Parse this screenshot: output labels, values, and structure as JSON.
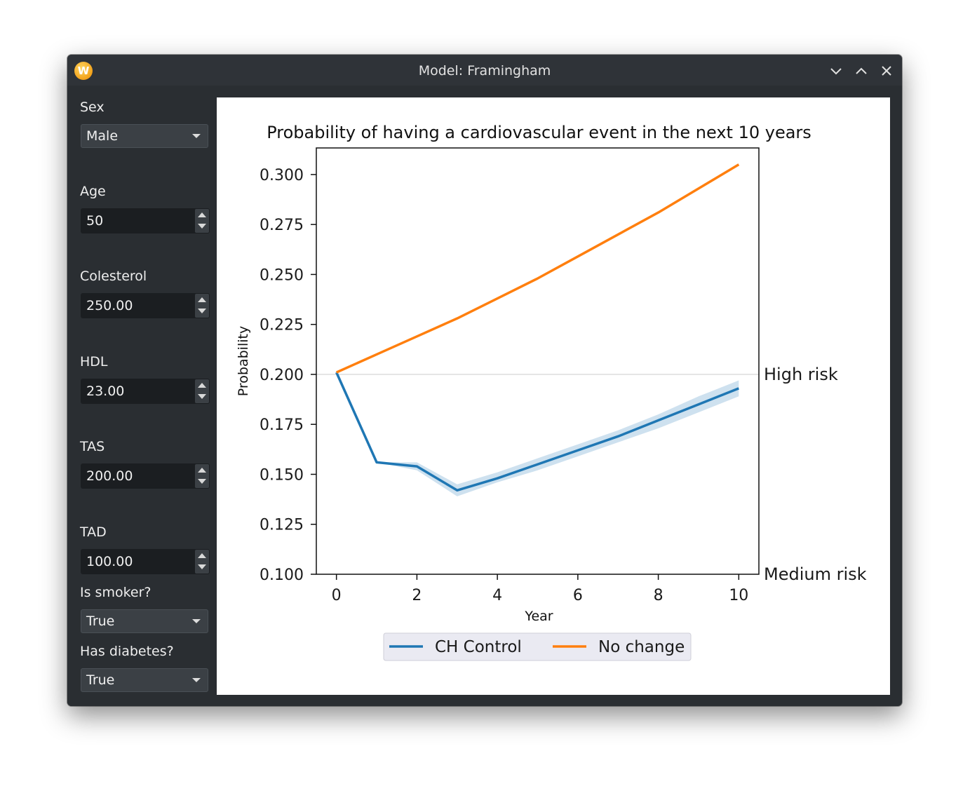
{
  "window": {
    "title": "Model: Framingham",
    "app_icon_letter": "W"
  },
  "sidebar": {
    "sex": {
      "label": "Sex",
      "value": "Male"
    },
    "age": {
      "label": "Age",
      "value": "50"
    },
    "cholesterol": {
      "label": "Colesterol",
      "value": "250.00"
    },
    "hdl": {
      "label": "HDL",
      "value": "23.00"
    },
    "tas": {
      "label": "TAS",
      "value": "200.00"
    },
    "tad": {
      "label": "TAD",
      "value": "100.00"
    },
    "smoker": {
      "label": "Is smoker?",
      "value": "True"
    },
    "diabetes": {
      "label": "Has diabetes?",
      "value": "True"
    }
  },
  "chart_data": {
    "type": "line",
    "title": "Probability of having a cardiovascular event in the next 10 years",
    "xlabel": "Year",
    "ylabel": "Probability",
    "xlim": [
      -0.5,
      10.5
    ],
    "ylim": [
      0.1,
      0.3133
    ],
    "x_ticks": [
      "0",
      "2",
      "4",
      "6",
      "8",
      "10"
    ],
    "y_ticks": [
      "0.100",
      "0.125",
      "0.150",
      "0.175",
      "0.200",
      "0.225",
      "0.250",
      "0.275",
      "0.300"
    ],
    "legend_position": "bottom-center",
    "reference_lines": [
      {
        "y": 0.2,
        "label": "High risk"
      },
      {
        "y": 0.1,
        "label": "Medium risk"
      }
    ],
    "series": [
      {
        "name": "CH Control",
        "color": "#1f77b4",
        "x": [
          0,
          1,
          2,
          3,
          4,
          5,
          6,
          7,
          8,
          9,
          10
        ],
        "y": [
          0.201,
          0.156,
          0.154,
          0.142,
          0.148,
          0.155,
          0.162,
          0.169,
          0.177,
          0.185,
          0.193
        ],
        "ci_lower": [
          0.201,
          0.156,
          0.152,
          0.139,
          0.146,
          0.152,
          0.159,
          0.166,
          0.173,
          0.181,
          0.189
        ],
        "ci_upper": [
          0.201,
          0.156,
          0.156,
          0.145,
          0.151,
          0.158,
          0.165,
          0.172,
          0.18,
          0.189,
          0.197
        ]
      },
      {
        "name": "No change",
        "color": "#ff7f0e",
        "x": [
          0,
          1,
          2,
          3,
          4,
          5,
          6,
          7,
          8,
          9,
          10
        ],
        "y": [
          0.201,
          0.21,
          0.219,
          0.228,
          0.238,
          0.248,
          0.259,
          0.27,
          0.281,
          0.293,
          0.305
        ]
      }
    ]
  }
}
